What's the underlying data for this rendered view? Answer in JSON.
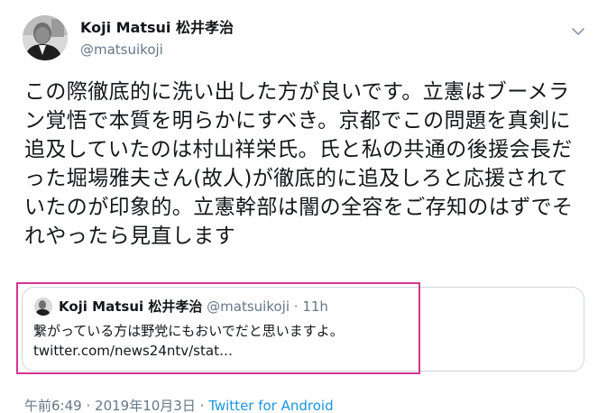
{
  "author": {
    "name": "Koji Matsui 松井孝治",
    "handle": "@matsuikoji"
  },
  "tweet": {
    "text": "この際徹底的に洗い出した方が良いです。立憲はブーメラン覚悟で本質を明らかにすべき。京都でこの問題を真剣に追及していたのは村山祥栄氏。氏と私の共通の後援会長だった堀場雅夫さん(故人)が徹底的に追及しろと応援されていたのが印象的。立憲幹部は闇の全容をご存知のはずでそれやったら見直します"
  },
  "quoted_tweet": {
    "name": "Koji Matsui 松井孝治",
    "handle": "@matsuikoji",
    "separator": "·",
    "time": "11h",
    "text": "繋がっている方は野党にもおいでだと思いますよ。",
    "link": "twitter.com/news24ntv/stat…"
  },
  "meta": {
    "time": "午前6:49",
    "separator1": "·",
    "date": "2019年10月3日",
    "separator2": "·",
    "source": "Twitter for Android"
  },
  "icons": {
    "caret": "chevron-down-icon",
    "avatar": "profile-photo"
  },
  "colors": {
    "highlight": "#d23591",
    "link": "#1b95e0",
    "secondary_text": "#657786",
    "border": "#ccd6dd"
  }
}
